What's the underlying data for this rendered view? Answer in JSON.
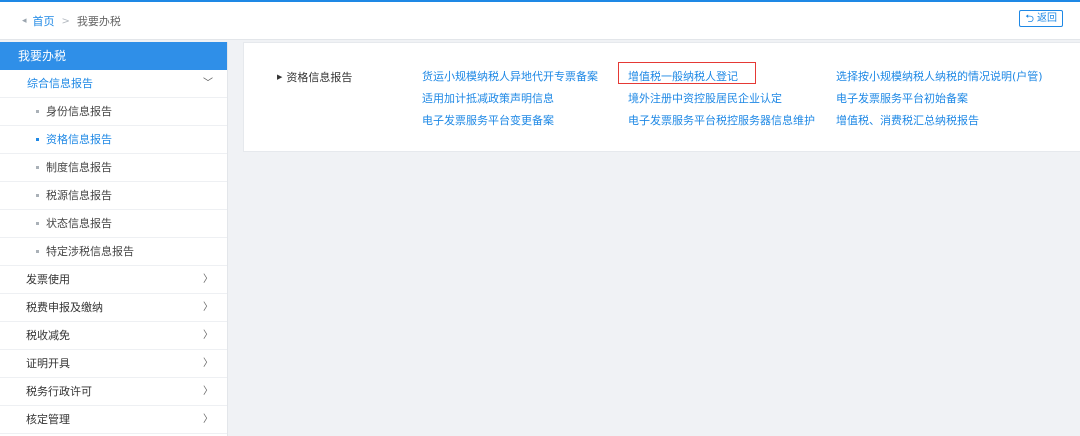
{
  "breadcrumb": {
    "home": "首页",
    "separator": ">",
    "current": "我要办税"
  },
  "header": {
    "back_label": "返回"
  },
  "sidebar": {
    "title": "我要办税",
    "section": "综合信息报告",
    "sub_items": [
      {
        "label": "身份信息报告",
        "active": false
      },
      {
        "label": "资格信息报告",
        "active": true
      },
      {
        "label": "制度信息报告",
        "active": false
      },
      {
        "label": "税源信息报告",
        "active": false
      },
      {
        "label": "状态信息报告",
        "active": false
      },
      {
        "label": "特定涉税信息报告",
        "active": false
      }
    ],
    "groups": [
      "发票使用",
      "税费申报及缴纳",
      "税收减免",
      "证明开具",
      "税务行政许可",
      "核定管理"
    ]
  },
  "panel": {
    "category": "资格信息报告",
    "links": [
      [
        "货运小规模纳税人异地代开专票备案",
        "增值税一般纳税人登记",
        "选择按小规模纳税人纳税的情况说明(户管)"
      ],
      [
        "适用加计抵减政策声明信息",
        "境外注册中资控股居民企业认定",
        "电子发票服务平台初始备案"
      ],
      [
        "电子发票服务平台变更备案",
        "电子发票服务平台税控服务器信息维护",
        "增值税、消费税汇总纳税报告"
      ]
    ],
    "highlighted": "增值税一般纳税人登记"
  },
  "colors": {
    "accent": "#1e88e5",
    "sidebar_header": "#2f8fe8",
    "highlight_border": "#e53935"
  }
}
